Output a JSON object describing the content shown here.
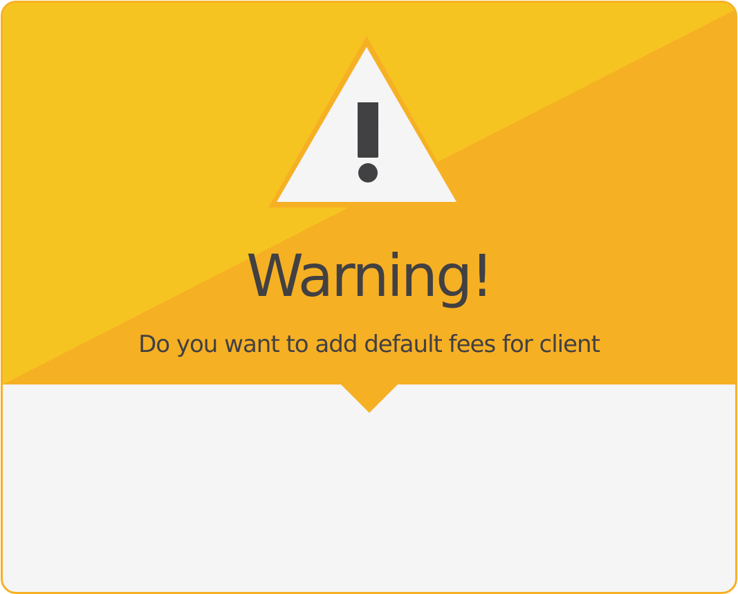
{
  "dialog": {
    "title": "Warning!",
    "message": "Do you want to add default fees for client",
    "icon": "warning-triangle-icon"
  },
  "colors": {
    "header_light": "#f6c421",
    "header_dark": "#f6b024",
    "border": "#f7b024",
    "body": "#f4f5f4",
    "text": "#414042",
    "icon_fill": "#f4f5f4"
  }
}
